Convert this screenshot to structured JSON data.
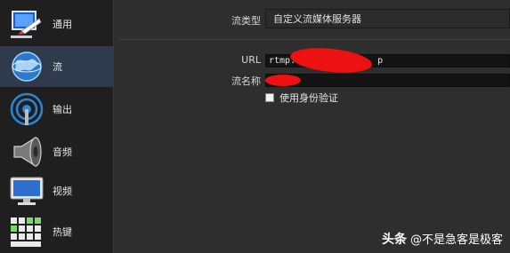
{
  "sidebar": {
    "items": [
      {
        "label": "通用",
        "icon": "general-settings-icon"
      },
      {
        "label": "流",
        "icon": "stream-globe-icon",
        "active": true
      },
      {
        "label": "输出",
        "icon": "output-antenna-icon"
      },
      {
        "label": "音频",
        "icon": "audio-speaker-icon"
      },
      {
        "label": "视频",
        "icon": "video-monitor-icon"
      },
      {
        "label": "热键",
        "icon": "hotkeys-keyboard-icon"
      }
    ]
  },
  "stream": {
    "type_label": "流类型",
    "type_value": "自定义流媒体服务器",
    "url_label": "URL",
    "url_prefix": "rtmp:",
    "url_suffix": "p",
    "key_label": "流名称",
    "auth_label": "使用身份验证",
    "auth_checked": false
  },
  "watermark": {
    "brand": "头条",
    "handle": "@不是急客是极客"
  },
  "colors": {
    "active_nav": "#2f3b4d",
    "redaction": "#ee1111"
  }
}
